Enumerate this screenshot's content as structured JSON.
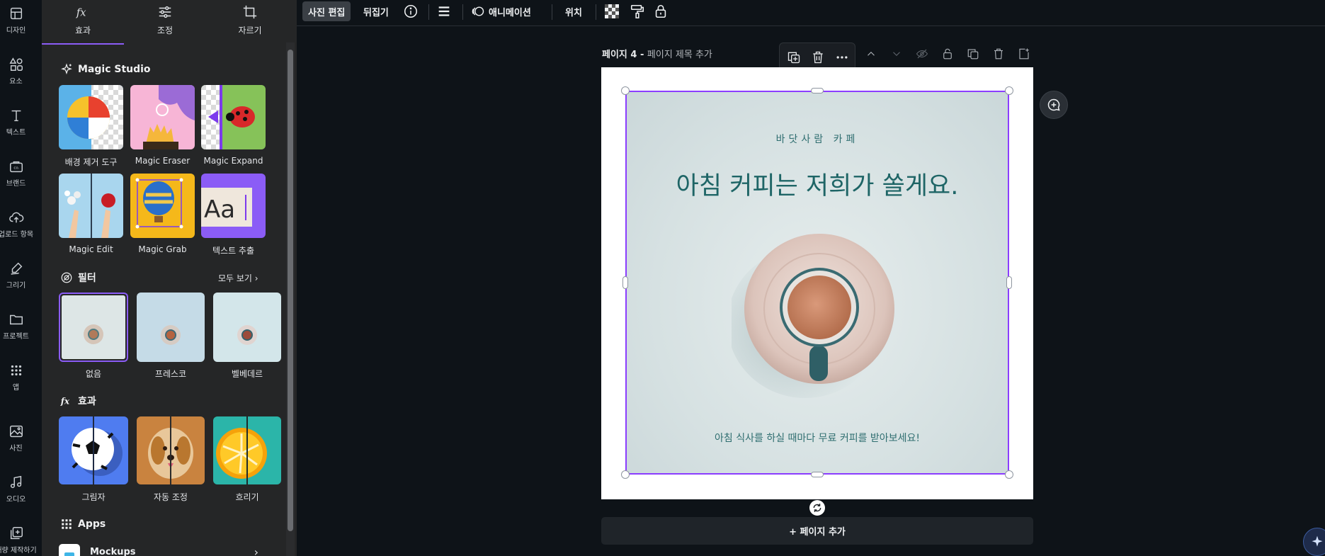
{
  "rail": {
    "items": [
      {
        "label": "디자인",
        "icon": "design-icon"
      },
      {
        "label": "요소",
        "icon": "elements-icon"
      },
      {
        "label": "텍스트",
        "icon": "text-icon"
      },
      {
        "label": "브랜드",
        "icon": "brand-icon"
      },
      {
        "label": "업로드 항목",
        "icon": "upload-icon"
      },
      {
        "label": "그리기",
        "icon": "draw-icon"
      },
      {
        "label": "프로젝트",
        "icon": "folder-icon"
      },
      {
        "label": "앱",
        "icon": "apps-icon"
      },
      {
        "label": "사진",
        "icon": "photo-icon"
      },
      {
        "label": "오디오",
        "icon": "audio-icon"
      },
      {
        "label": "대량 제작하기",
        "icon": "bulk-create-icon"
      }
    ]
  },
  "panel": {
    "tabs": [
      {
        "label": "효과",
        "icon": "fx-icon",
        "active": true
      },
      {
        "label": "조정",
        "icon": "sliders-icon",
        "active": false
      },
      {
        "label": "자르기",
        "icon": "crop-icon",
        "active": false
      }
    ],
    "magic_studio": {
      "title": "Magic Studio",
      "tools": [
        {
          "label": "배경 제거 도구"
        },
        {
          "label": "Magic Eraser"
        },
        {
          "label": "Magic Expand"
        },
        {
          "label": "Magic Edit"
        },
        {
          "label": "Magic Grab"
        },
        {
          "label": "텍스트 추출"
        }
      ]
    },
    "filters": {
      "title": "필터",
      "see_all": "모두 보기",
      "items": [
        {
          "label": "없음",
          "selected": true
        },
        {
          "label": "프레스코",
          "selected": false
        },
        {
          "label": "벨베데르",
          "selected": false
        }
      ]
    },
    "effects": {
      "title": "효과",
      "items": [
        {
          "label": "그림자"
        },
        {
          "label": "자동 조정"
        },
        {
          "label": "흐리기"
        }
      ]
    },
    "apps": {
      "title": "Apps",
      "first_item": "Mockups"
    }
  },
  "toolbar": {
    "edit_photo": "사진 편집",
    "flip": "뒤집기",
    "animate": "애니메이션",
    "position": "위치"
  },
  "page": {
    "label": "페이지 4",
    "title_placeholder": "페이지 제목 추가",
    "add_page": "+ 페이지 추가"
  },
  "design": {
    "brand": "바닷사람 카페",
    "headline": "아침 커피는 저희가 쏠게요.",
    "footer": "아침 식사를 하실 때마다 무료 커피를 받아보세요!"
  },
  "colors": {
    "accent": "#8b3dff",
    "text_teal": "#1e6566",
    "panel_bg": "#252627",
    "app_bg": "#0e1318"
  }
}
